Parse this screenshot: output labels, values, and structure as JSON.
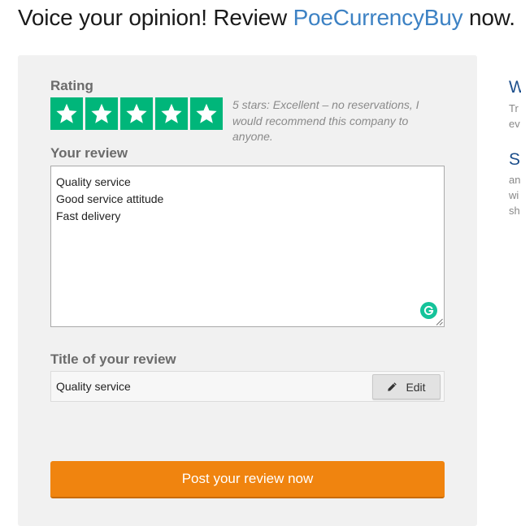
{
  "header": {
    "title_prefix": "Voice your opinion! Review ",
    "company": "PoeCurrencyBuy",
    "title_suffix": " now."
  },
  "rating": {
    "label": "Rating",
    "stars": 5,
    "max_stars": 5,
    "star_color": "#00b67a",
    "description": "5 stars: Excellent – no reservations, I would recommend this company to anyone."
  },
  "review": {
    "label": "Your review",
    "lines": [
      "Quality service",
      "Good service attitude",
      "Fast delivery"
    ]
  },
  "review_title": {
    "label": "Title of your review",
    "value": "Quality service",
    "edit_label": "Edit"
  },
  "submit": {
    "label": "Post your review now",
    "color": "#f0840f"
  },
  "sidebar": {
    "sections": [
      {
        "heading": "W",
        "lines": [
          "Tr",
          "ev"
        ]
      },
      {
        "heading": "S",
        "lines": [
          "an",
          "wi",
          "sh"
        ]
      }
    ]
  },
  "colors": {
    "link": "#3d82c4",
    "panel_bg": "#f1f1f1"
  },
  "icons": {
    "star": "star-icon",
    "grammarly": "grammarly-icon",
    "edit": "pencil-icon"
  }
}
